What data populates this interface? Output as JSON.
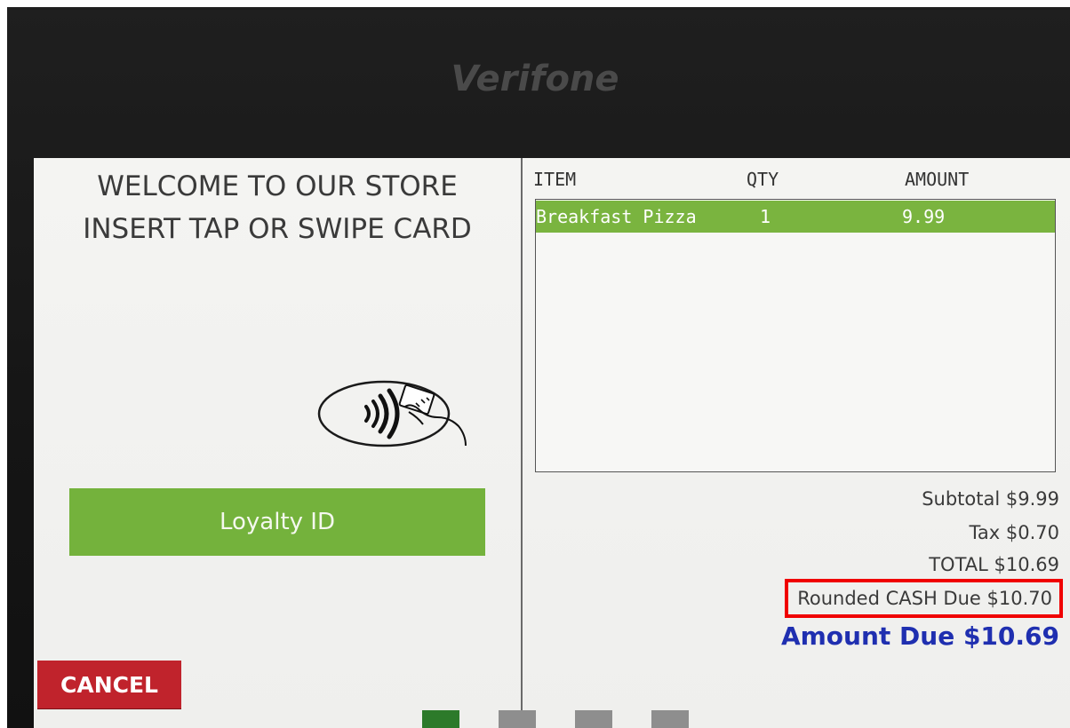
{
  "device": {
    "brand": "Verifone"
  },
  "welcome": {
    "line1": "WELCOME TO OUR STORE",
    "line2": "INSERT TAP OR SWIPE CARD"
  },
  "buttons": {
    "loyalty_label": "Loyalty ID",
    "cancel_label": "CANCEL"
  },
  "icons": {
    "contactless": "contactless-tap-icon"
  },
  "table": {
    "headers": {
      "item": "ITEM",
      "qty": "QTY",
      "amount": "AMOUNT"
    },
    "rows": [
      {
        "item": "Breakfast Pizza",
        "qty": "1",
        "amount": "9.99",
        "selected": true
      }
    ]
  },
  "totals": {
    "subtotal": "Subtotal $9.99",
    "tax": "Tax $0.70",
    "total": "TOTAL $10.69",
    "rounded_cash": "Rounded CASH Due $10.70",
    "amount_due": "Amount Due $10.69"
  },
  "colors": {
    "accent_green": "#74b23c",
    "cancel_red": "#c0232c",
    "amount_due_blue": "#1f2fb0",
    "highlight_box": "#f00000"
  },
  "indicators": [
    {
      "active": true
    },
    {
      "active": false
    },
    {
      "active": false
    },
    {
      "active": false
    }
  ]
}
